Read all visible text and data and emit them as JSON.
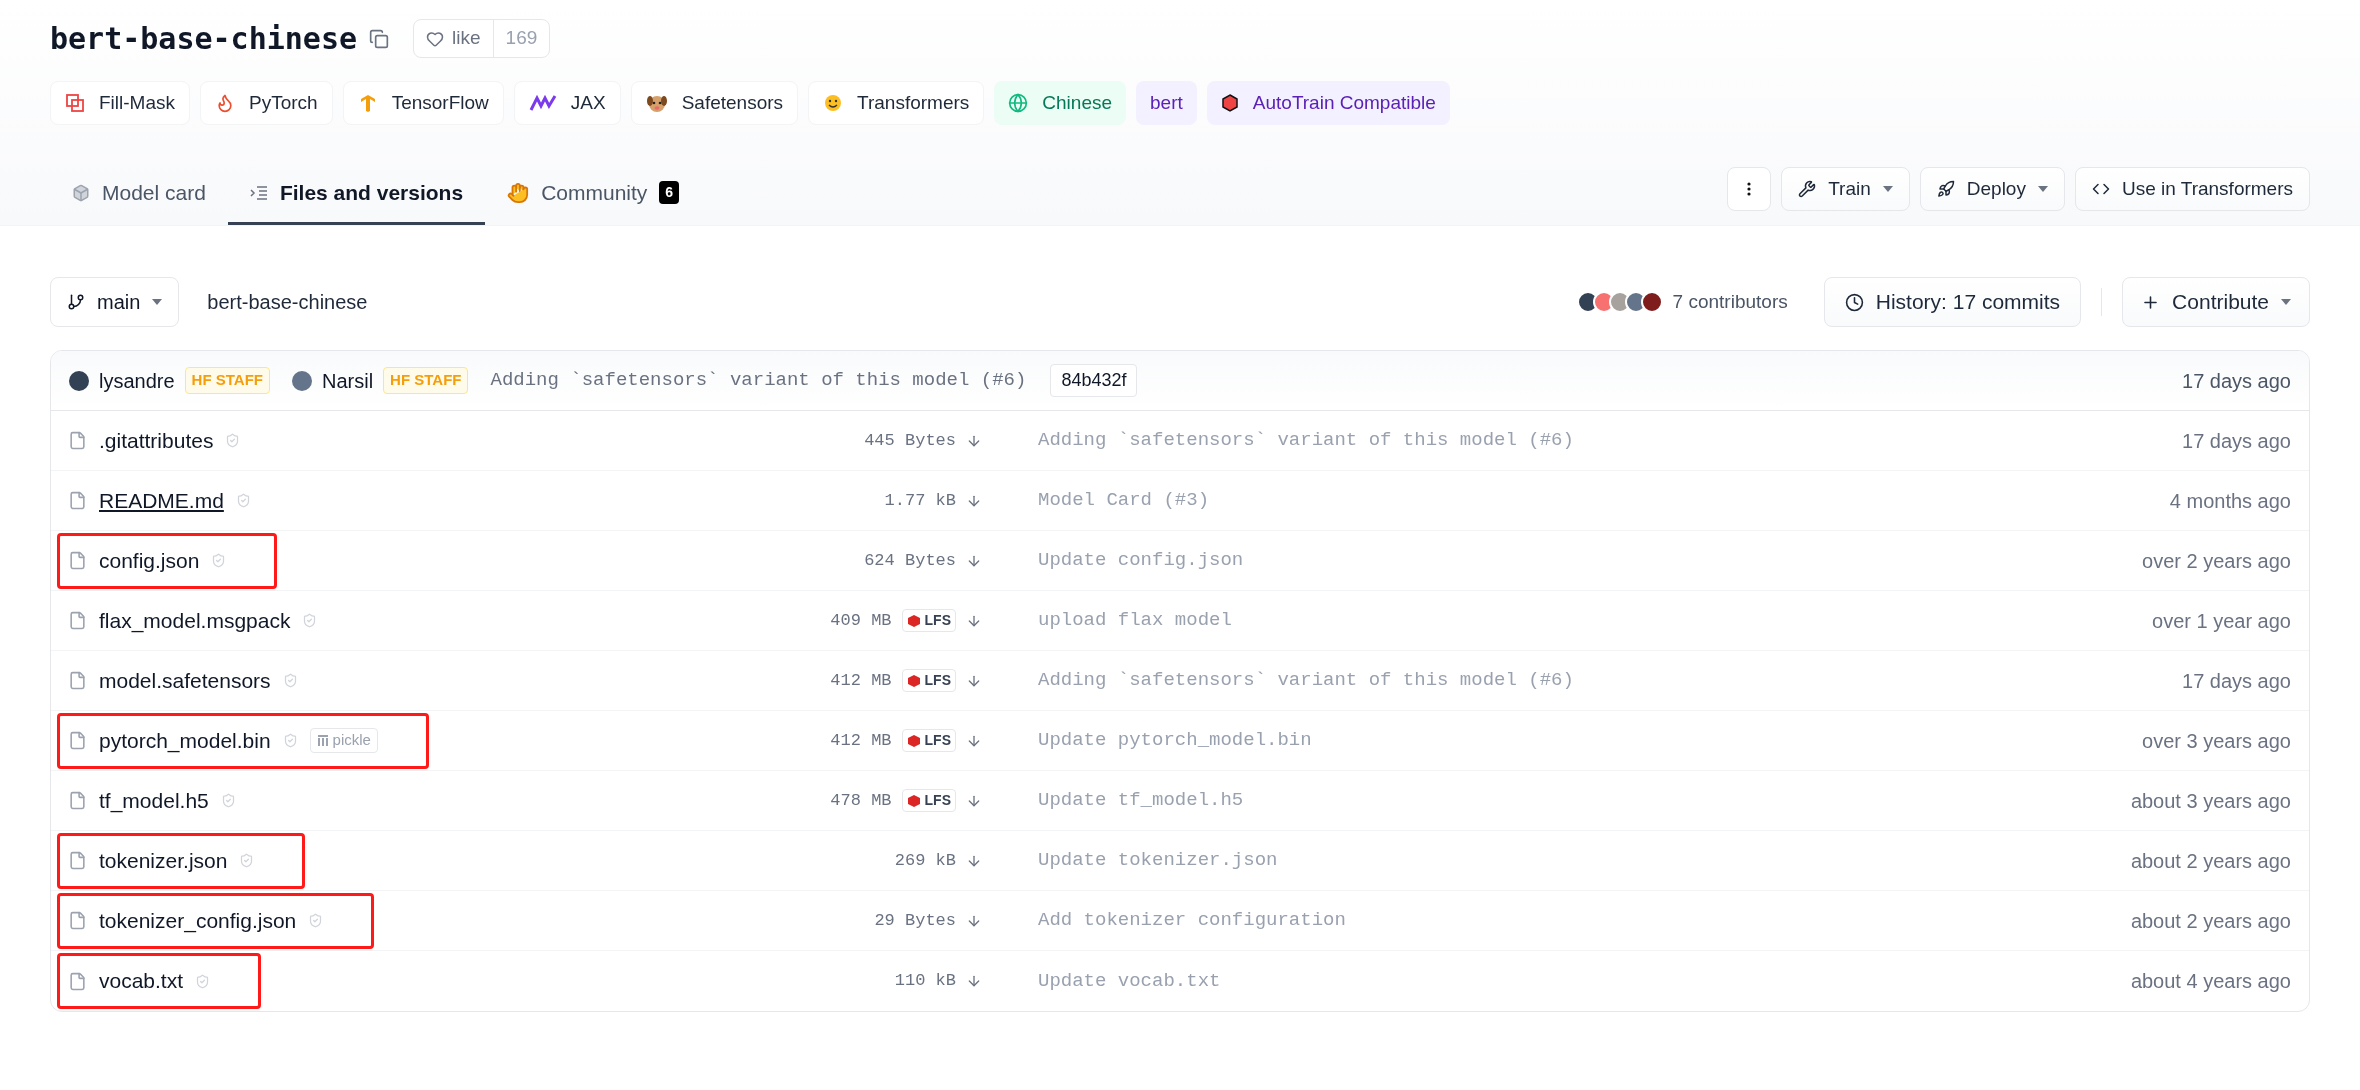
{
  "model": {
    "title": "bert-base-chinese",
    "like_label": "like",
    "like_count": "169"
  },
  "tags": [
    {
      "label": "Fill-Mask",
      "kind": "task"
    },
    {
      "label": "PyTorch",
      "kind": "library"
    },
    {
      "label": "TensorFlow",
      "kind": "library"
    },
    {
      "label": "JAX",
      "kind": "library"
    },
    {
      "label": "Safetensors",
      "kind": "library"
    },
    {
      "label": "Transformers",
      "kind": "library"
    },
    {
      "label": "Chinese",
      "kind": "language"
    },
    {
      "label": "bert",
      "kind": "other"
    },
    {
      "label": "AutoTrain Compatible",
      "kind": "other"
    }
  ],
  "tabs": [
    {
      "label": "Model card",
      "selected": false
    },
    {
      "label": "Files and versions",
      "selected": true
    },
    {
      "label": "Community",
      "selected": false,
      "count": "6"
    }
  ],
  "actions": [
    {
      "label": "Train",
      "kind": "train"
    },
    {
      "label": "Deploy",
      "kind": "deploy"
    },
    {
      "label": "Use in Transformers",
      "kind": "code"
    }
  ],
  "branch": {
    "name": "main",
    "path": "bert-base-chinese",
    "contributors": "7 contributors",
    "history": "History: 17 commits",
    "contribute": "Contribute"
  },
  "last_commit": {
    "authors": [
      {
        "name": "lysandre",
        "badge": "HF STAFF"
      },
      {
        "name": "Narsil",
        "badge": "HF STAFF"
      }
    ],
    "message": "Adding `safetensors` variant of this model (#6)",
    "hash": "84b432f",
    "date": "17 days ago"
  },
  "files": [
    {
      "name": ".gitattributes",
      "size": "445 Bytes",
      "lfs": false,
      "message": "Adding `safetensors` variant of this model (#6)",
      "date": "17 days ago",
      "hovered": false,
      "highlighted": false
    },
    {
      "name": "README.md",
      "size": "1.77 kB",
      "lfs": false,
      "message": "Model Card (#3)",
      "date": "4 months ago",
      "hovered": true,
      "highlighted": false
    },
    {
      "name": "config.json",
      "size": "624 Bytes",
      "lfs": false,
      "message": "Update config.json",
      "date": "over 2 years ago",
      "hovered": false,
      "highlighted": true
    },
    {
      "name": "flax_model.msgpack",
      "size": "409 MB",
      "lfs": "LFS",
      "message": "upload flax model",
      "date": "over 1 year ago",
      "hovered": false,
      "highlighted": false
    },
    {
      "name": "model.safetensors",
      "size": "412 MB",
      "lfs": "LFS",
      "message": "Adding `safetensors` variant of this model (#6)",
      "date": "17 days ago",
      "hovered": false,
      "highlighted": false
    },
    {
      "name": "pytorch_model.bin",
      "size": "412 MB",
      "lfs": "LFS",
      "pickle": "pickle",
      "message": "Update pytorch_model.bin",
      "date": "over 3 years ago",
      "hovered": false,
      "highlighted": true
    },
    {
      "name": "tf_model.h5",
      "size": "478 MB",
      "lfs": "LFS",
      "message": "Update tf_model.h5",
      "date": "about 3 years ago",
      "hovered": false,
      "highlighted": false
    },
    {
      "name": "tokenizer.json",
      "size": "269 kB",
      "lfs": false,
      "message": "Update tokenizer.json",
      "date": "about 2 years ago",
      "hovered": false,
      "highlighted": true
    },
    {
      "name": "tokenizer_config.json",
      "size": "29 Bytes",
      "lfs": false,
      "message": "Add tokenizer configuration",
      "date": "about 2 years ago",
      "hovered": false,
      "highlighted": true
    },
    {
      "name": "vocab.txt",
      "size": "110 kB",
      "lfs": false,
      "message": "Update vocab.txt",
      "date": "about 4 years ago",
      "hovered": false,
      "highlighted": true
    }
  ]
}
